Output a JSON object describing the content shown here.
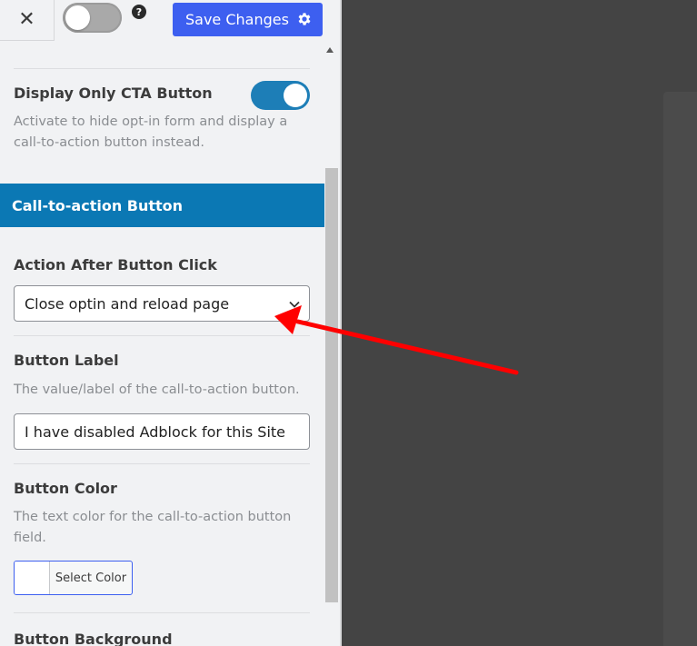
{
  "topbar": {
    "close_glyph": "✕",
    "help_glyph": "?",
    "save_label": "Save Changes"
  },
  "cta_toggle": {
    "title": "Display Only CTA Button",
    "description": "Activate to hide opt-in form and display a call-to-action button instead.",
    "enabled": true
  },
  "header_toggle_enabled": false,
  "section": {
    "title": "Call-to-action Button"
  },
  "action_after_click": {
    "label": "Action After Button Click",
    "selected": "Close optin and reload page"
  },
  "button_label": {
    "label": "Button Label",
    "description": "The value/label of the call-to-action button.",
    "value": "I have disabled Adblock for this Site"
  },
  "button_color": {
    "label": "Button Color",
    "description": "The text color for the call-to-action button field.",
    "select_label": "Select Color",
    "swatch_color": "#ffffff"
  },
  "button_background": {
    "label": "Button Background"
  },
  "colors": {
    "accent_blue": "#3d5ff0",
    "section_blue": "#0b78b4",
    "toggle_on": "#1d7eb7",
    "annotation_arrow": "#ff0000"
  }
}
